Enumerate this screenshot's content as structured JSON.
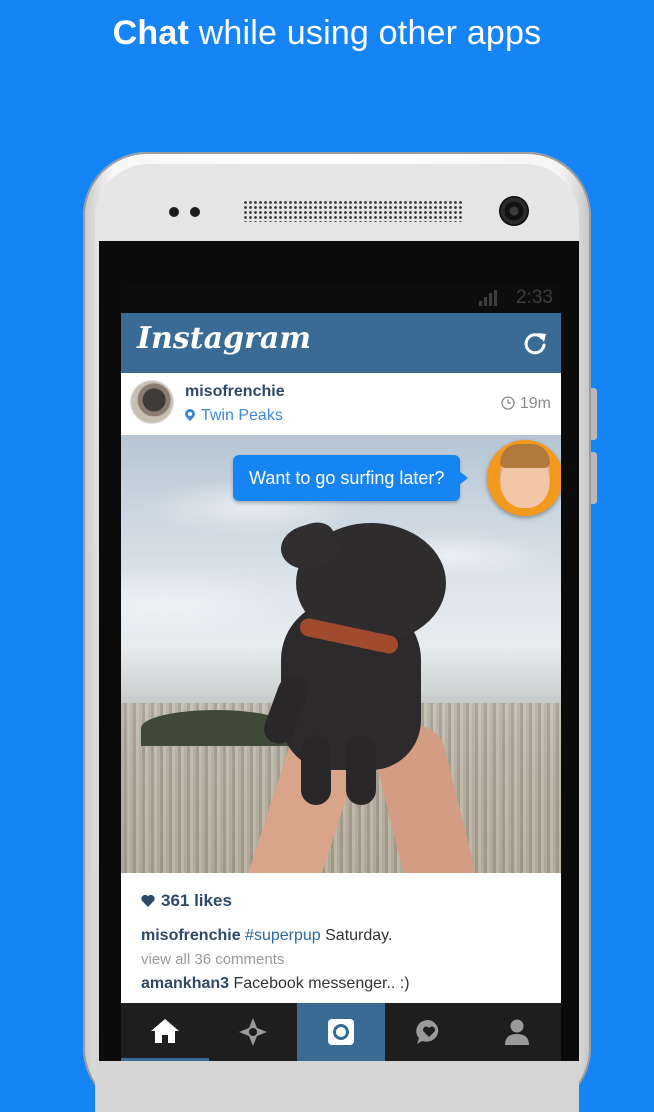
{
  "headline": {
    "bold": "Chat",
    "rest": " while using other apps"
  },
  "status_bar": {
    "time": "2:33"
  },
  "app": {
    "name": "Instagram"
  },
  "post": {
    "username": "misofrenchie",
    "location": "Twin Peaks",
    "time_ago": "19m",
    "likes": "361 likes",
    "caption_user": "misofrenchie",
    "caption_tag": "#superpup",
    "caption_text": " Saturday.",
    "view_comments": "view all 36 comments",
    "comment_user": "amankhan3",
    "comment_text": " Facebook messenger.. :)"
  },
  "chat_head": {
    "message": "Want to go surfing later?"
  },
  "tabs": [
    {
      "icon": "home-icon"
    },
    {
      "icon": "explore-icon"
    },
    {
      "icon": "camera-icon"
    },
    {
      "icon": "news-icon"
    },
    {
      "icon": "profile-icon"
    }
  ],
  "colors": {
    "background": "#1584f7",
    "ig_bar": "#3a6b95",
    "bubble": "#1684f2",
    "chat_head_ring": "#f39a1e"
  }
}
